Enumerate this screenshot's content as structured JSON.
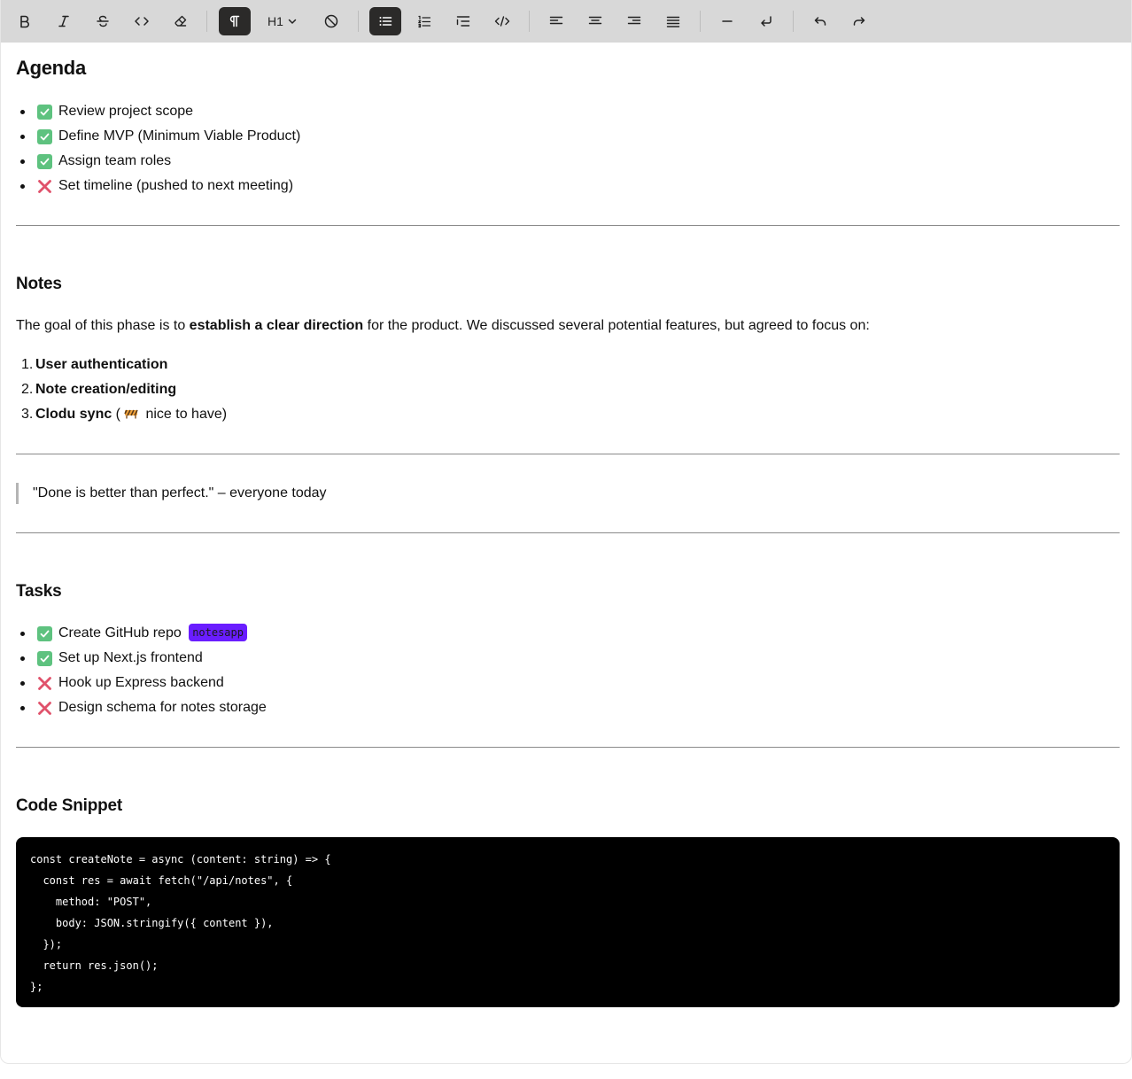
{
  "toolbar": {
    "heading_label": "H1",
    "buttons": [
      "bold",
      "italic",
      "strikethrough",
      "inline-code",
      "clear-format",
      "paragraph",
      "heading",
      "block",
      "bullet-list",
      "ordered-list",
      "indent-list",
      "code-block",
      "align-left",
      "align-center",
      "align-right",
      "align-justify",
      "horizontal-rule",
      "hard-break",
      "undo",
      "redo"
    ],
    "active": [
      "paragraph",
      "bullet-list"
    ]
  },
  "agenda": {
    "title": "Agenda",
    "items": [
      {
        "status": "done",
        "text": "Review project scope"
      },
      {
        "status": "done",
        "text": "Define MVP (Minimum Viable Product)"
      },
      {
        "status": "done",
        "text": "Assign team roles"
      },
      {
        "status": "not-done",
        "text": "Set timeline (pushed to next meeting)"
      }
    ]
  },
  "notes": {
    "title": "Notes",
    "para_before": "The goal of this phase is to ",
    "para_bold": "establish a clear direction",
    "para_after": " for the product. We discussed several potential features, but agreed to focus on:",
    "items": [
      {
        "num": "1.",
        "bold": "User authentication",
        "rest": ""
      },
      {
        "num": "2.",
        "bold": "Note creation/editing",
        "rest": ""
      },
      {
        "num": "3.",
        "bold": "Clodu sync",
        "rest_pre": " (",
        "rest_post": " nice to have)"
      }
    ]
  },
  "quote": {
    "text": "\"Done is better than perfect.\" – everyone today"
  },
  "tasks": {
    "title": "Tasks",
    "items": [
      {
        "status": "done",
        "text": "Create GitHub repo ",
        "chip": "notesapp"
      },
      {
        "status": "done",
        "text": "Set up Next.js frontend"
      },
      {
        "status": "not-done",
        "text": "Hook up Express backend"
      },
      {
        "status": "not-done",
        "text": "Design schema for notes storage"
      }
    ]
  },
  "code": {
    "title": "Code Snippet",
    "lines": [
      "const createNote = async (content: string) => {",
      "  const res = await fetch(\"/api/notes\", {",
      "    method: \"POST\",",
      "    body: JSON.stringify({ content }),",
      "  });",
      "  return res.json();",
      "};"
    ]
  },
  "colors": {
    "toolbar_bg": "#d8d8d8",
    "active_btn": "#2b2a29",
    "check_green": "#5ec27f",
    "cross_red": "#e0526b",
    "chip_purple": "#6a1dff",
    "code_bg": "#000000"
  }
}
